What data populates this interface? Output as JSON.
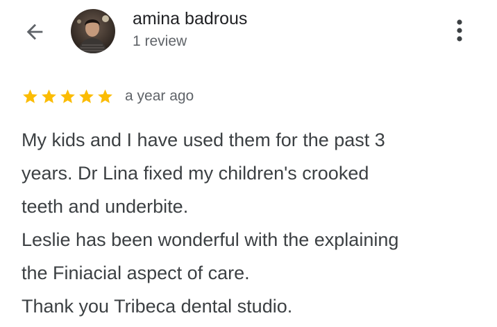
{
  "header": {
    "back_icon": "arrow-left-icon",
    "reviewer_name": "amina badrous",
    "review_count": "1 review",
    "avatar_icon": "profile-photo",
    "more_icon": "more-vert-icon"
  },
  "review": {
    "rating": 5,
    "rating_max": 5,
    "star_color": "#fbbc04",
    "date": "a year ago",
    "lines": [
      "My kids and I have used them for the past 3",
      "years. Dr Lina fixed my children's crooked",
      "teeth and underbite.",
      "Leslie has been wonderful with the explaining",
      "the Finiacial aspect of care.",
      "Thank you Tribeca dental studio."
    ]
  }
}
